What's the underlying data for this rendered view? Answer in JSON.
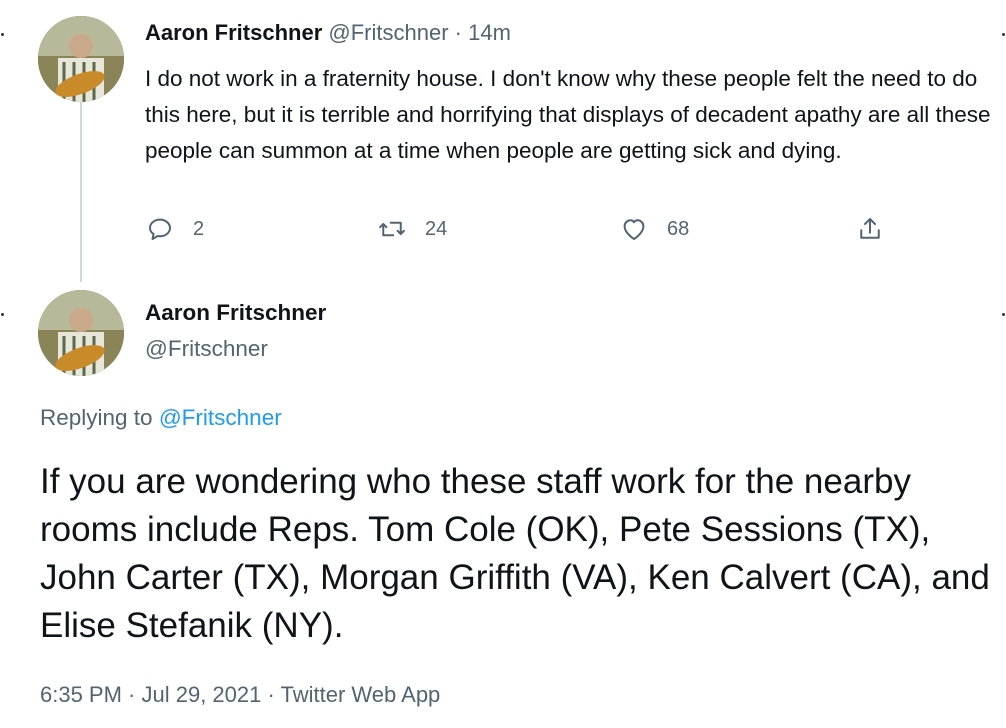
{
  "tweet1": {
    "author_name": "Aaron Fritschner",
    "handle": "@Fritschner",
    "separator": "·",
    "time": "14m",
    "body": "I do not work in a fraternity house. I don't know why these people felt the need to do this here, but it is terrible and horrifying that displays of decadent apathy are all these people can summon at a time when people are getting sick and dying.",
    "actions": {
      "reply_count": "2",
      "retweet_count": "24",
      "like_count": "68"
    }
  },
  "tweet2": {
    "author_name": "Aaron Fritschner",
    "handle": "@Fritschner",
    "replying_prefix": "Replying to",
    "replying_handle": "@Fritschner",
    "body": "If you are wondering who these staff work for the nearby rooms include Reps. Tom Cole (OK), Pete Sessions (TX), John Carter (TX), Morgan Griffith (VA), Ken Calvert (CA), and Elise Stefanik (NY).",
    "timestamp": "6:35 PM · Jul 29, 2021 · Twitter Web App"
  },
  "icons": {
    "reply": "comment-icon",
    "retweet": "retweet-icon",
    "like": "heart-icon",
    "share": "share-icon"
  },
  "colors": {
    "text": "#0f1419",
    "muted": "#536471",
    "link": "#1d9bf0",
    "thread_line": "#cfd9de"
  }
}
